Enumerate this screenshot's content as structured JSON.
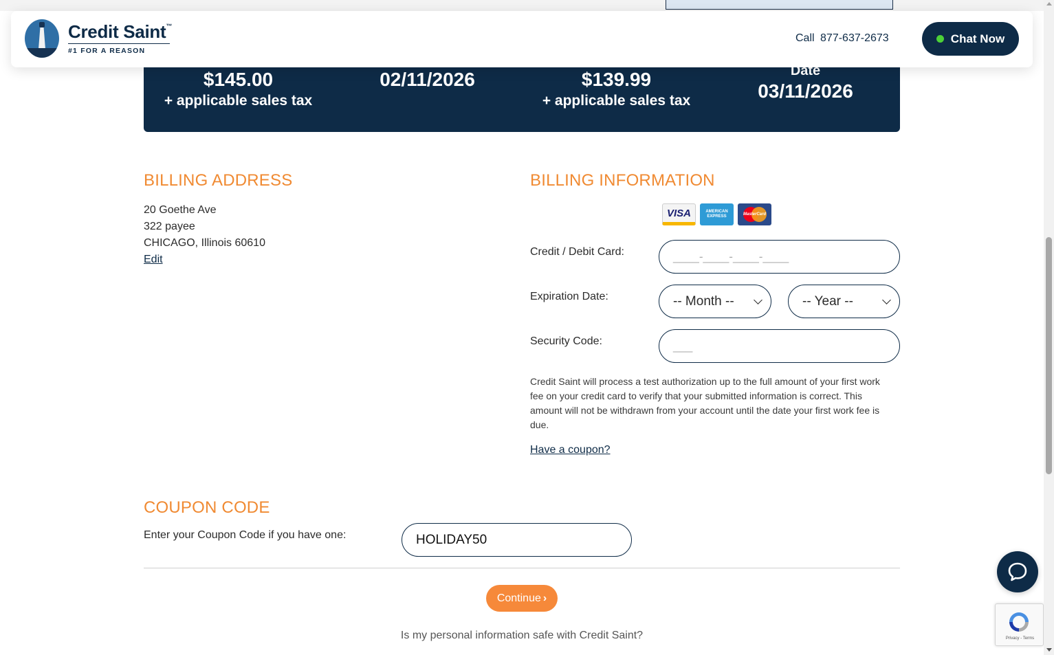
{
  "header": {
    "brand_name": "Credit Saint",
    "brand_tm": "™",
    "tagline": "#1 FOR A REASON",
    "call_label": "Call",
    "phone": "877-637-2673",
    "chat_label": "Chat Now"
  },
  "summary": {
    "first_fee": "$145.00",
    "first_fee_note": "+ applicable sales tax",
    "first_date": "02/11/2026",
    "second_fee": "$139.99",
    "second_fee_note": "+ applicable sales tax",
    "second_date_label": "Date",
    "second_date": "03/11/2026"
  },
  "billing_address": {
    "title": "BILLING ADDRESS",
    "line1": "20 Goethe Ave",
    "line2": "322 payee",
    "line3": "CHICAGO, Illinois 60610",
    "edit_label": "Edit"
  },
  "billing_info": {
    "title": "BILLING INFORMATION",
    "cards": [
      "VISA",
      "AMERICAN EXPRESS",
      "MasterCard"
    ],
    "card_label": "Credit / Debit Card:",
    "card_placeholder": "____-____-____-____",
    "expiration_label": "Expiration Date:",
    "month_selected": "-- Month --",
    "year_selected": "-- Year --",
    "security_label": "Security Code:",
    "security_placeholder": "___",
    "note": "Credit Saint will process a test authorization up to the full amount of your first work fee on your credit card to verify that your submitted information is correct. This amount will not be withdrawn from your account until the date your first work fee is due.",
    "coupon_link": "Have a coupon?"
  },
  "coupon": {
    "title": "COUPON CODE",
    "label": "Enter your Coupon Code if you have one:",
    "value": "HOLIDAY50"
  },
  "actions": {
    "continue_label": "Continue",
    "continue_arrow": "›",
    "safe_question": "Is my personal information safe with Credit Saint?"
  },
  "recaptcha": {
    "footer": "Privacy - Terms"
  },
  "colors": {
    "navy": "#0e2b47",
    "orange": "#f08a32",
    "button_orange": "#f6893a",
    "online_green": "#4cd137"
  }
}
